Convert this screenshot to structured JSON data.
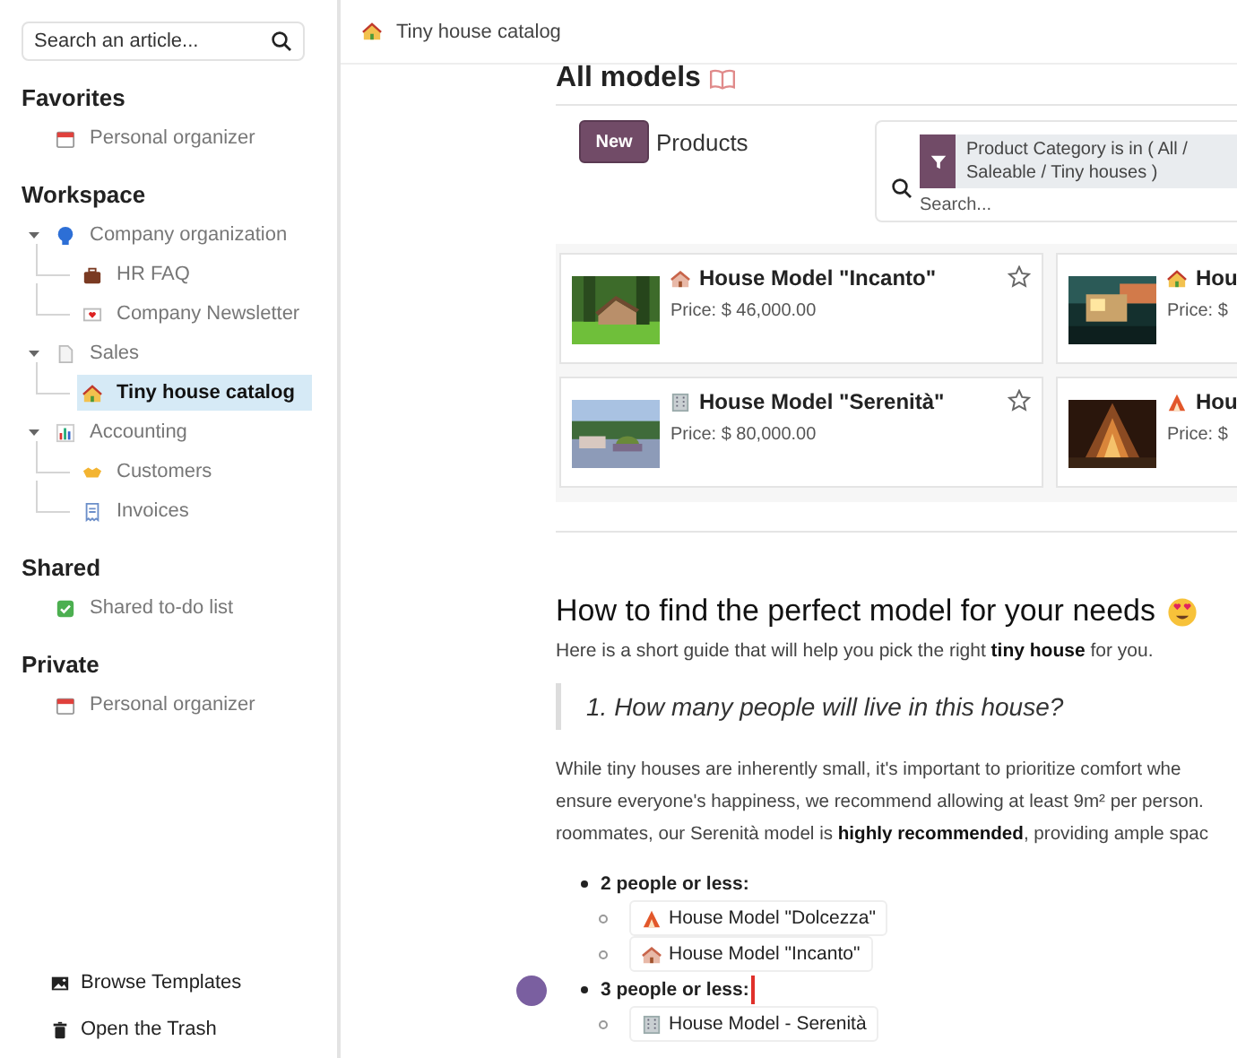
{
  "sidebar": {
    "search": {
      "placeholder": "Search an article..."
    },
    "sections": [
      {
        "title": "Favorites",
        "items": [
          {
            "label": "Personal organizer",
            "selected": false
          }
        ]
      },
      {
        "title": "Workspace",
        "items": [
          {
            "label": "Company organization",
            "selected": false,
            "expanded": true,
            "children": [
              {
                "label": "HR FAQ",
                "selected": false
              },
              {
                "label": "Company Newsletter",
                "selected": false
              }
            ]
          },
          {
            "label": "Sales",
            "selected": false,
            "expanded": true,
            "children": [
              {
                "label": "Tiny house catalog",
                "selected": true
              }
            ]
          },
          {
            "label": "Accounting",
            "selected": false,
            "expanded": true,
            "children": [
              {
                "label": "Customers",
                "selected": false
              },
              {
                "label": "Invoices",
                "selected": false
              }
            ]
          }
        ]
      },
      {
        "title": "Shared",
        "items": [
          {
            "label": "Shared to-do list",
            "selected": false
          }
        ]
      },
      {
        "title": "Private",
        "items": [
          {
            "label": "Personal organizer",
            "selected": false
          }
        ]
      }
    ],
    "footer": [
      "Browse Templates",
      "Open the Trash"
    ]
  },
  "breadcrumb": "Tiny house catalog",
  "article": {
    "heading": "All models",
    "embed": {
      "new_button": "New",
      "title": "Products",
      "facet": "Product Category is in ( All / Saleable / Tiny houses )",
      "search_placeholder": "Search...",
      "cards": [
        {
          "name": "House Model \"Incanto\"",
          "price": "Price: $ 46,000.00",
          "starred": false
        },
        {
          "name": "Hou",
          "price": "Price: $"
        },
        {
          "name": "House Model \"Serenità\"",
          "price": "Price: $ 80,000.00",
          "starred": false
        },
        {
          "name": "Hou",
          "price": "Price: $"
        }
      ]
    },
    "guide_heading": "How to find the perfect model for your needs",
    "intro": "Here is a short guide that will help you pick the right **tiny house** for you.",
    "question": "1. How many people will live in this house?",
    "paragraph": "While tiny houses are inherently small, it's important to prioritize comfort whe\nensure everyone's happiness, we recommend allowing at least 9m² per person.\nroommates, our Serenità model is **highly recommended**, providing ample spac",
    "groups": [
      {
        "label": "2 people or less:",
        "collaborator": false,
        "models": [
          "House Model \"Dolcezza\"",
          "House Model \"Incanto\""
        ]
      },
      {
        "label": "3 people or less:",
        "collaborator": true,
        "models": [
          "House Model - Serenità"
        ]
      }
    ]
  }
}
